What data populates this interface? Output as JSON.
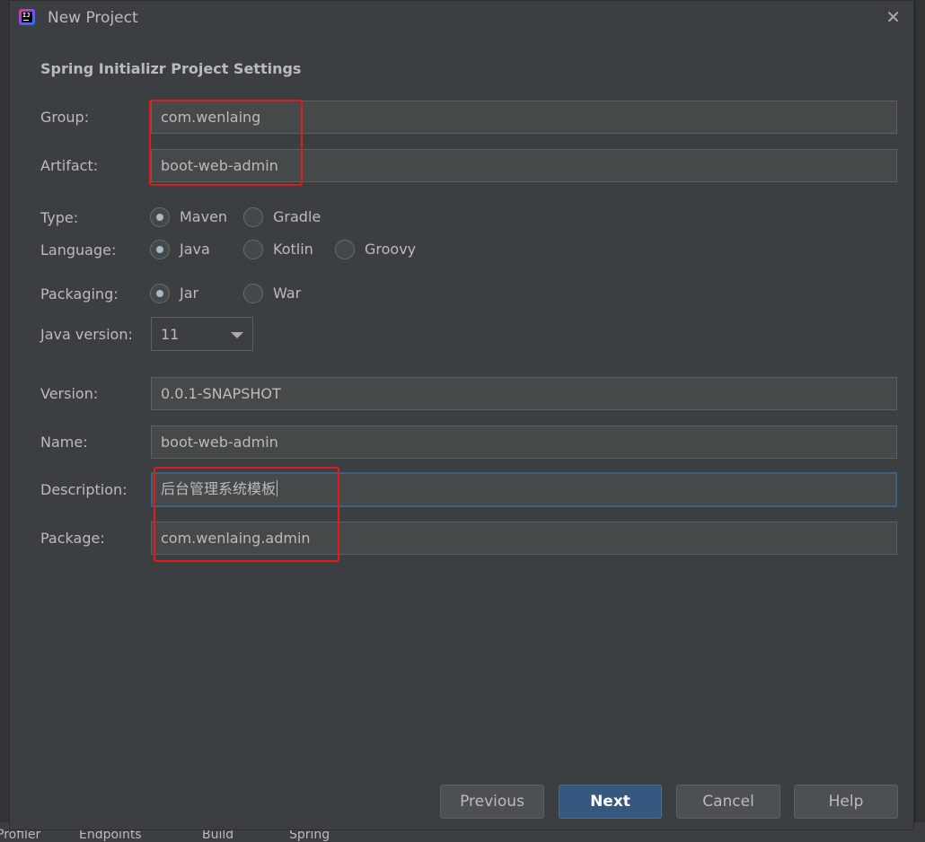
{
  "dialog": {
    "title": "New Project",
    "section_title": "Spring Initializr Project Settings"
  },
  "fields": {
    "group": {
      "label": "Group:",
      "value": "com.wenlaing"
    },
    "artifact": {
      "label": "Artifact:",
      "value": "boot-web-admin"
    },
    "version": {
      "label": "Version:",
      "value": "0.0.1-SNAPSHOT"
    },
    "name": {
      "label": "Name:",
      "value": "boot-web-admin"
    },
    "description": {
      "label": "Description:",
      "value": "后台管理系统模板"
    },
    "package": {
      "label": "Package:",
      "value": "com.wenlaing.admin"
    }
  },
  "type": {
    "label": "Type:",
    "options": [
      "Maven",
      "Gradle"
    ],
    "selected": "Maven"
  },
  "language": {
    "label": "Language:",
    "options": [
      "Java",
      "Kotlin",
      "Groovy"
    ],
    "selected": "Java"
  },
  "packaging": {
    "label": "Packaging:",
    "options": [
      "Jar",
      "War"
    ],
    "selected": "Jar"
  },
  "java_version": {
    "label": "Java version:",
    "value": "11"
  },
  "buttons": {
    "previous": "Previous",
    "next": "Next",
    "cancel": "Cancel",
    "help": "Help"
  },
  "background": {
    "bottom_tabs": [
      "Profiler",
      "Endpoints",
      "Build",
      "Spring"
    ]
  },
  "colors": {
    "dialog_bg": "#3c3f41",
    "field_bg": "#45494a",
    "primary_button": "#365880",
    "highlight": "#e41a1a"
  }
}
